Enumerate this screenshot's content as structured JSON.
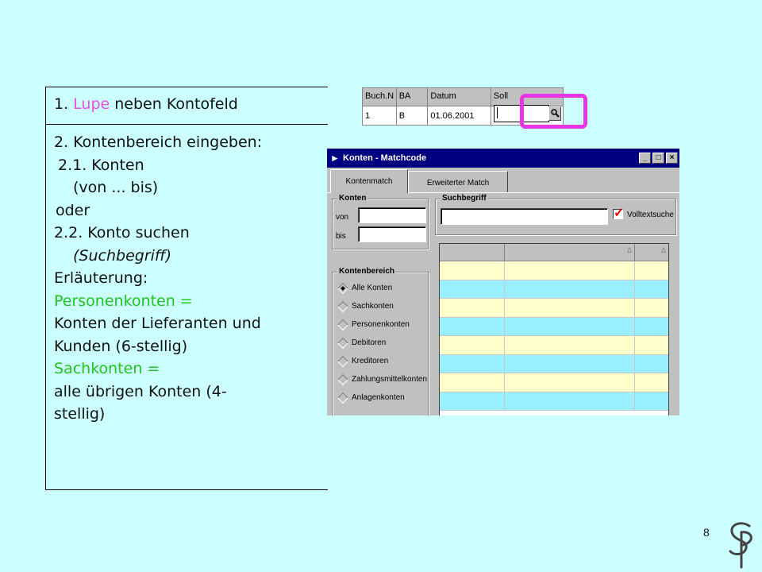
{
  "slide": {
    "step1": {
      "number": "1. ",
      "highlight": "Lupe",
      "rest": " neben Kontofeld"
    },
    "step2": {
      "heading": "2. Kontenbereich eingeben:",
      "sub1": "2.1. Konten",
      "sub1_detail": "(von ... bis)",
      "or": "oder",
      "sub2": "2.2. Konto suchen",
      "sub2_detail": "(Suchbegriff)",
      "explain_title": "Erläuterung:",
      "def1_term": "Personenkonten =",
      "def1_text_a": "Konten der Lieferanten und",
      "def1_text_b": "Kunden (6-stellig)",
      "def2_term": "Sachkonten =",
      "def2_text_a": "alle übrigen Konten (4-",
      "def2_text_b": "stellig)"
    },
    "page_number": "8",
    "colors": {
      "background": "#ccffff",
      "highlight": "#e64ee6",
      "term": "#22c422",
      "frame": "#e636e6"
    }
  },
  "mini_table": {
    "headers": [
      "Buch.N",
      "BA",
      "Datum",
      "Soll"
    ],
    "row": [
      "1",
      "B",
      "01.06.2001",
      ""
    ],
    "lupe_icon": "magnifier-icon"
  },
  "dialog": {
    "title": "Konten - Matchcode",
    "title_icon": "app-icon",
    "buttons": {
      "minimize": "_",
      "maximize": "□",
      "close": "×"
    },
    "tabs": [
      {
        "label": "Kontenmatch",
        "active": true
      },
      {
        "label": "Erweiterter Match",
        "active": false
      }
    ],
    "group_konten": {
      "label": "Konten",
      "von": "von",
      "bis": "bis"
    },
    "group_such": {
      "label": "Suchbegriff",
      "checkbox_label": "Volltextsuche",
      "checked": true
    },
    "group_bereich": {
      "label": "Kontenbereich",
      "options": [
        "Alle Konten",
        "Sachkonten",
        "Personenkonten",
        "Debitoren",
        "Kreditoren",
        "Zahlungsmittelkonten",
        "Anlagenkonten"
      ],
      "selected": 0
    },
    "grid": {
      "header_marks": [
        "",
        "Δ",
        "Δ"
      ],
      "row_colors": [
        "#ffffcc",
        "#99eeff"
      ]
    }
  }
}
